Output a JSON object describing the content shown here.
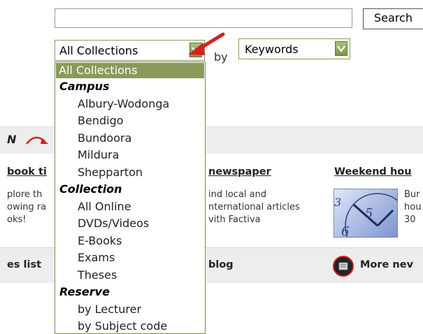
{
  "search": {
    "button_label": "Search"
  },
  "collection_select": {
    "value": "All Collections"
  },
  "by_label": "by",
  "field_select": {
    "value": "Keywords"
  },
  "dropdown": {
    "options": [
      {
        "label": "All Collections",
        "kind": "selected"
      },
      {
        "label": "Campus",
        "kind": "group"
      },
      {
        "label": "Albury-Wodonga",
        "kind": "item"
      },
      {
        "label": "Bendigo",
        "kind": "item"
      },
      {
        "label": "Bundoora",
        "kind": "item"
      },
      {
        "label": "Mildura",
        "kind": "item"
      },
      {
        "label": "Shepparton",
        "kind": "item"
      },
      {
        "label": "Collection",
        "kind": "group"
      },
      {
        "label": "All Online",
        "kind": "item"
      },
      {
        "label": "DVDs/Videos",
        "kind": "item"
      },
      {
        "label": "E-Books",
        "kind": "item"
      },
      {
        "label": "Exams",
        "kind": "item"
      },
      {
        "label": "Theses",
        "kind": "item"
      },
      {
        "label": "Reserve",
        "kind": "group"
      },
      {
        "label": "by Lecturer",
        "kind": "item"
      },
      {
        "label": "by Subject code",
        "kind": "item"
      }
    ]
  },
  "banner": {
    "text": "N"
  },
  "features": {
    "left": {
      "title": "book ti",
      "lines": [
        "plore th",
        "owing ra",
        "oks!"
      ]
    },
    "middle": {
      "title": "newspaper",
      "lines": [
        "ind local and",
        "nternational articles",
        "vith Factiva"
      ]
    },
    "right": {
      "title": "Weekend hou",
      "lines": [
        "Bur",
        "hou",
        "30"
      ]
    }
  },
  "bottom": {
    "left": "es list",
    "middle": "blog",
    "right": "More nev"
  },
  "colors": {
    "accent_green": "#8a9a5b",
    "arrow_red": "#d42020",
    "banner_gray": "#ededed"
  }
}
